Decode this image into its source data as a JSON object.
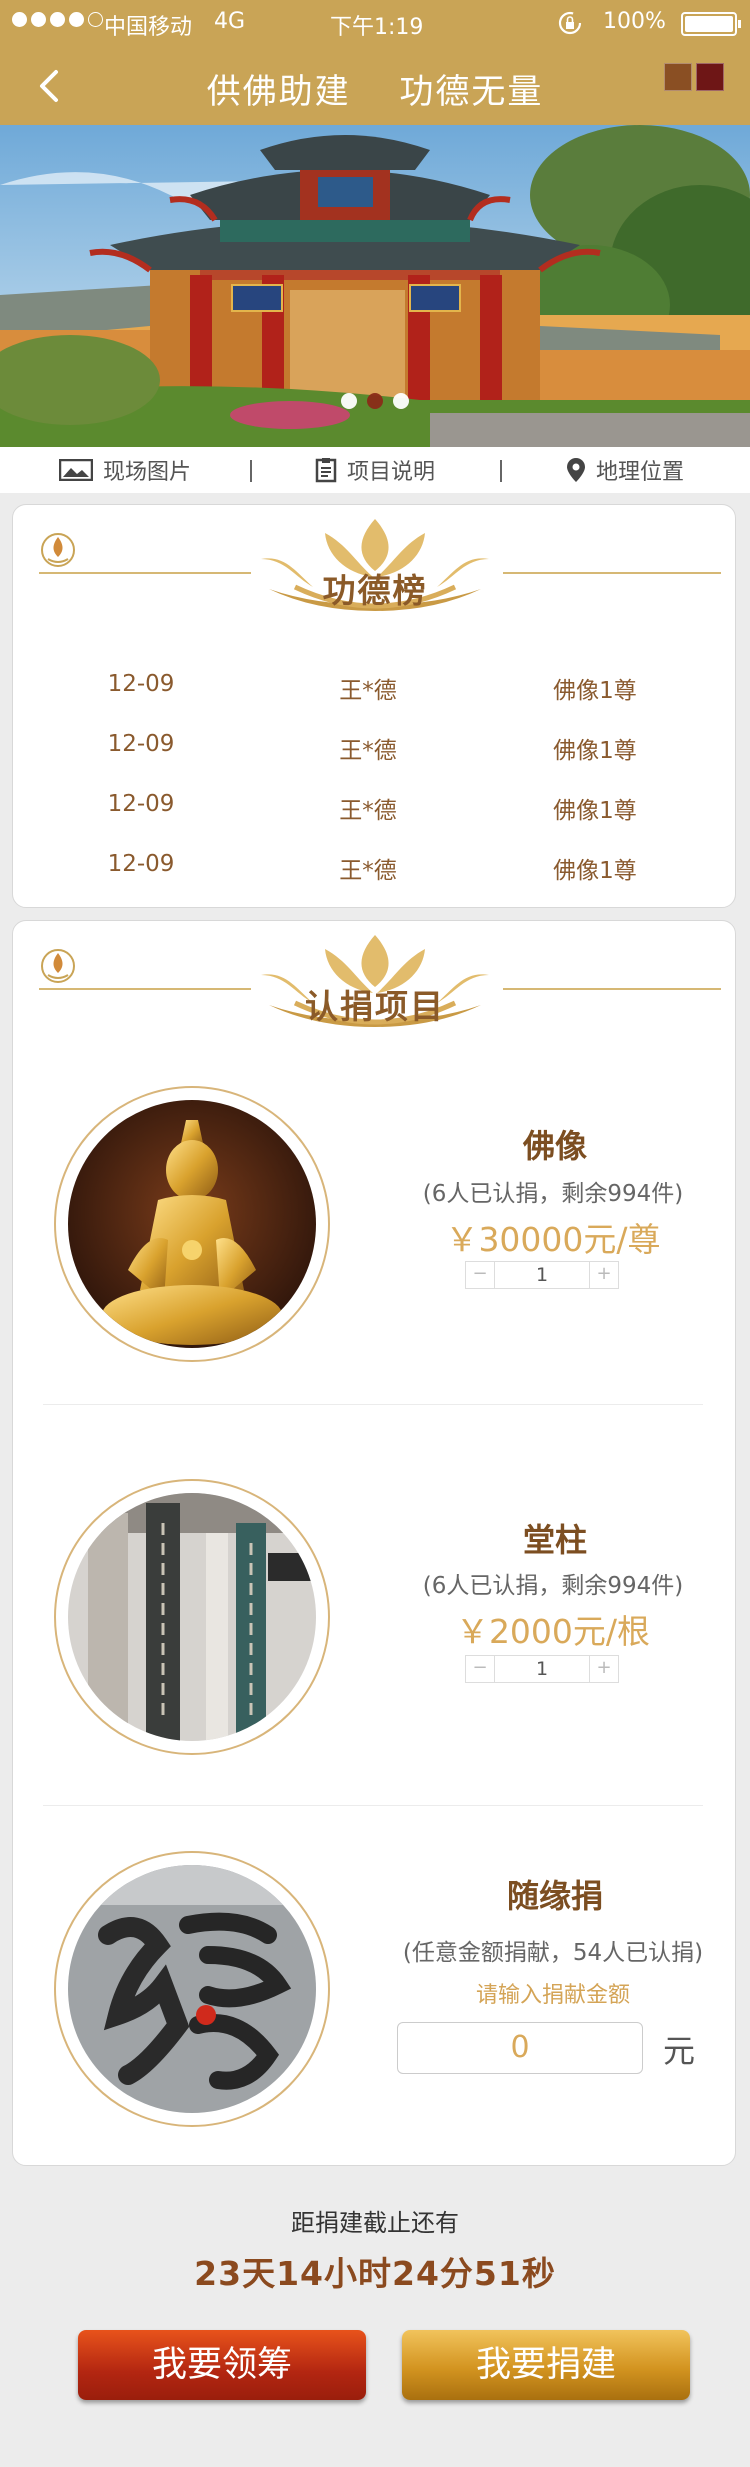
{
  "status_bar": {
    "carrier": "中国移动",
    "network": "4G",
    "time": "下午1:19",
    "battery": "100%"
  },
  "nav": {
    "title_left": "供佛助建",
    "title_right": "功德无量",
    "swatch_colors": [
      "#8a4f23",
      "#6e1616"
    ]
  },
  "banner": {
    "slides": 3,
    "active_slide": 1
  },
  "info_tabs": [
    {
      "label": "现场图片",
      "icon": "picture-icon"
    },
    {
      "label": "项目说明",
      "icon": "document-icon"
    },
    {
      "label": "地理位置",
      "icon": "location-pin-icon"
    }
  ],
  "merit": {
    "title": "功德榜",
    "rows": [
      {
        "date": "12-09",
        "name": "王*德",
        "item": "佛像1尊"
      },
      {
        "date": "12-09",
        "name": "王*德",
        "item": "佛像1尊"
      },
      {
        "date": "12-09",
        "name": "王*德",
        "item": "佛像1尊"
      },
      {
        "date": "12-09",
        "name": "王*德",
        "item": "佛像1尊"
      }
    ]
  },
  "projects": {
    "title": "认捐项目",
    "items": [
      {
        "name": "佛像",
        "subtitle": "(6人已认捐，剩余994件)",
        "price": "￥30000元/尊",
        "quantity": "1",
        "minus": "−",
        "plus": "+"
      },
      {
        "name": "堂柱",
        "subtitle": "(6人已认捐，剩余994件)",
        "price": "￥2000元/根",
        "quantity": "1",
        "minus": "−",
        "plus": "+"
      },
      {
        "name": "随缘捐",
        "subtitle": "(任意金额捐献，54人已认捐)",
        "hint": "请输入捐献金额",
        "amount": "0",
        "unit": "元"
      }
    ]
  },
  "footer": {
    "deadline_label": "距捐建截止还有",
    "countdown": "23天14小时24分51秒",
    "btn_fundraise": "我要领筹",
    "btn_donate": "我要捐建"
  },
  "colors": {
    "header": "#c9a456",
    "brown_text": "#8b5a28",
    "gold_text": "#d9a95a",
    "red_button": "#b32611",
    "gold_button": "#d39420"
  }
}
